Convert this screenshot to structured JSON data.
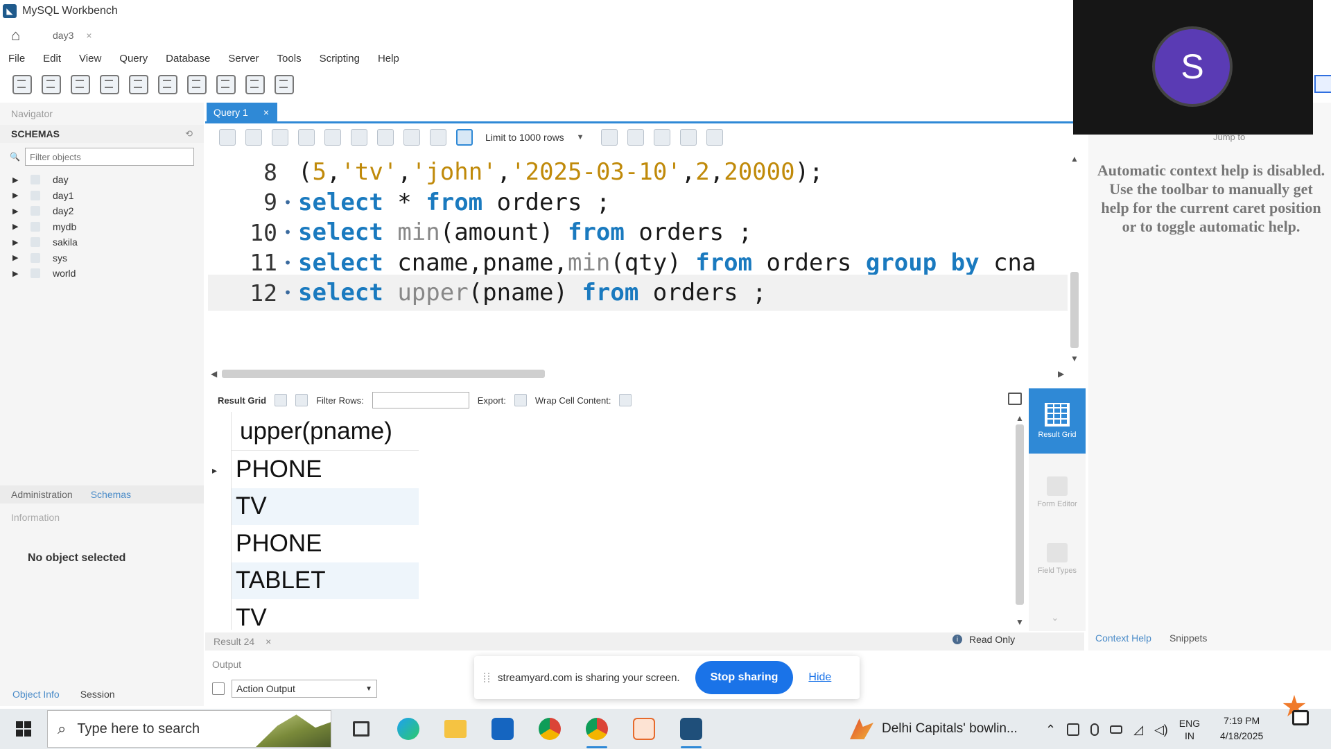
{
  "window": {
    "title": "MySQL Workbench"
  },
  "connection_tab": {
    "label": "day3",
    "close": "×"
  },
  "menu": [
    "File",
    "Edit",
    "View",
    "Query",
    "Database",
    "Server",
    "Tools",
    "Scripting",
    "Help"
  ],
  "navigator": {
    "label": "Navigator",
    "schemas_header": "SCHEMAS",
    "filter_placeholder": "Filter objects",
    "schemas": [
      "day",
      "day1",
      "day2",
      "mydb",
      "sakila",
      "sys",
      "world"
    ],
    "bottom_tabs": [
      "Administration",
      "Schemas"
    ],
    "information_label": "Information",
    "no_object": "No object selected",
    "footer_tabs": [
      "Object Info",
      "Session"
    ]
  },
  "query_tab": {
    "label": "Query 1",
    "close": "×"
  },
  "sql_toolbar": {
    "limit_label": "Limit to 1000 rows"
  },
  "editor": {
    "lines": [
      {
        "num": "8",
        "dot": "",
        "tokens": [
          [
            "p",
            "("
          ],
          [
            "n",
            "5"
          ],
          [
            "p",
            ","
          ],
          [
            "s",
            "'tv'"
          ],
          [
            "p",
            ","
          ],
          [
            "s",
            "'john'"
          ],
          [
            "p",
            ","
          ],
          [
            "s",
            "'2025-03-10'"
          ],
          [
            "p",
            ","
          ],
          [
            "n",
            "2"
          ],
          [
            "p",
            ","
          ],
          [
            "n",
            "20000"
          ],
          [
            "p",
            ");"
          ]
        ]
      },
      {
        "num": "9",
        "dot": "•",
        "tokens": [
          [
            "k",
            "select"
          ],
          [
            "p",
            " * "
          ],
          [
            "k",
            "from"
          ],
          [
            "p",
            " orders ;"
          ]
        ]
      },
      {
        "num": "10",
        "dot": "•",
        "tokens": [
          [
            "k",
            "select"
          ],
          [
            "p",
            " "
          ],
          [
            "f",
            "min"
          ],
          [
            "p",
            "(amount) "
          ],
          [
            "k",
            "from"
          ],
          [
            "p",
            " orders ;"
          ]
        ]
      },
      {
        "num": "11",
        "dot": "•",
        "tokens": [
          [
            "k",
            "select"
          ],
          [
            "p",
            " cname,pname,"
          ],
          [
            "f",
            "min"
          ],
          [
            "p",
            "(qty) "
          ],
          [
            "k",
            "from"
          ],
          [
            "p",
            " orders "
          ],
          [
            "k",
            "group by"
          ],
          [
            "p",
            " cna"
          ]
        ]
      },
      {
        "num": "12",
        "dot": "•",
        "tokens": [
          [
            "k",
            "select"
          ],
          [
            "p",
            " "
          ],
          [
            "f",
            "upper"
          ],
          [
            "p",
            "(pname) "
          ],
          [
            "k",
            "from"
          ],
          [
            "p",
            " orders ;"
          ]
        ]
      }
    ]
  },
  "result_toolbar": {
    "result_grid": "Result Grid",
    "filter_rows": "Filter Rows:",
    "export": "Export:",
    "wrap": "Wrap Cell Content:"
  },
  "result": {
    "column": "upper(pname)",
    "rows": [
      "PHONE",
      "TV",
      "PHONE",
      "TABLET",
      "TV"
    ]
  },
  "result_side": {
    "result_grid": "Result Grid",
    "form_editor": "Form Editor",
    "field_types": "Field Types"
  },
  "result_footer": {
    "tab": "Result 24",
    "close": "×",
    "read_only": "Read Only"
  },
  "output": {
    "label": "Output",
    "selector": "Action Output"
  },
  "help": {
    "jump_to": "Jump to",
    "text": "Automatic context help is disabled. Use the toolbar to manually get help for the current caret position or to toggle automatic help.",
    "tabs": [
      "Context Help",
      "Snippets"
    ]
  },
  "video": {
    "avatar_letter": "S",
    "avatar_color": "#5a3bb4"
  },
  "sharebar": {
    "message": "streamyard.com is sharing your screen.",
    "stop": "Stop sharing",
    "hide": "Hide"
  },
  "taskbar": {
    "search_placeholder": "Type here to search",
    "news": "Delhi Capitals' bowlin...",
    "lang_line1": "ENG",
    "lang_line2": "IN",
    "time": "7:19 PM",
    "date": "4/18/2025"
  }
}
